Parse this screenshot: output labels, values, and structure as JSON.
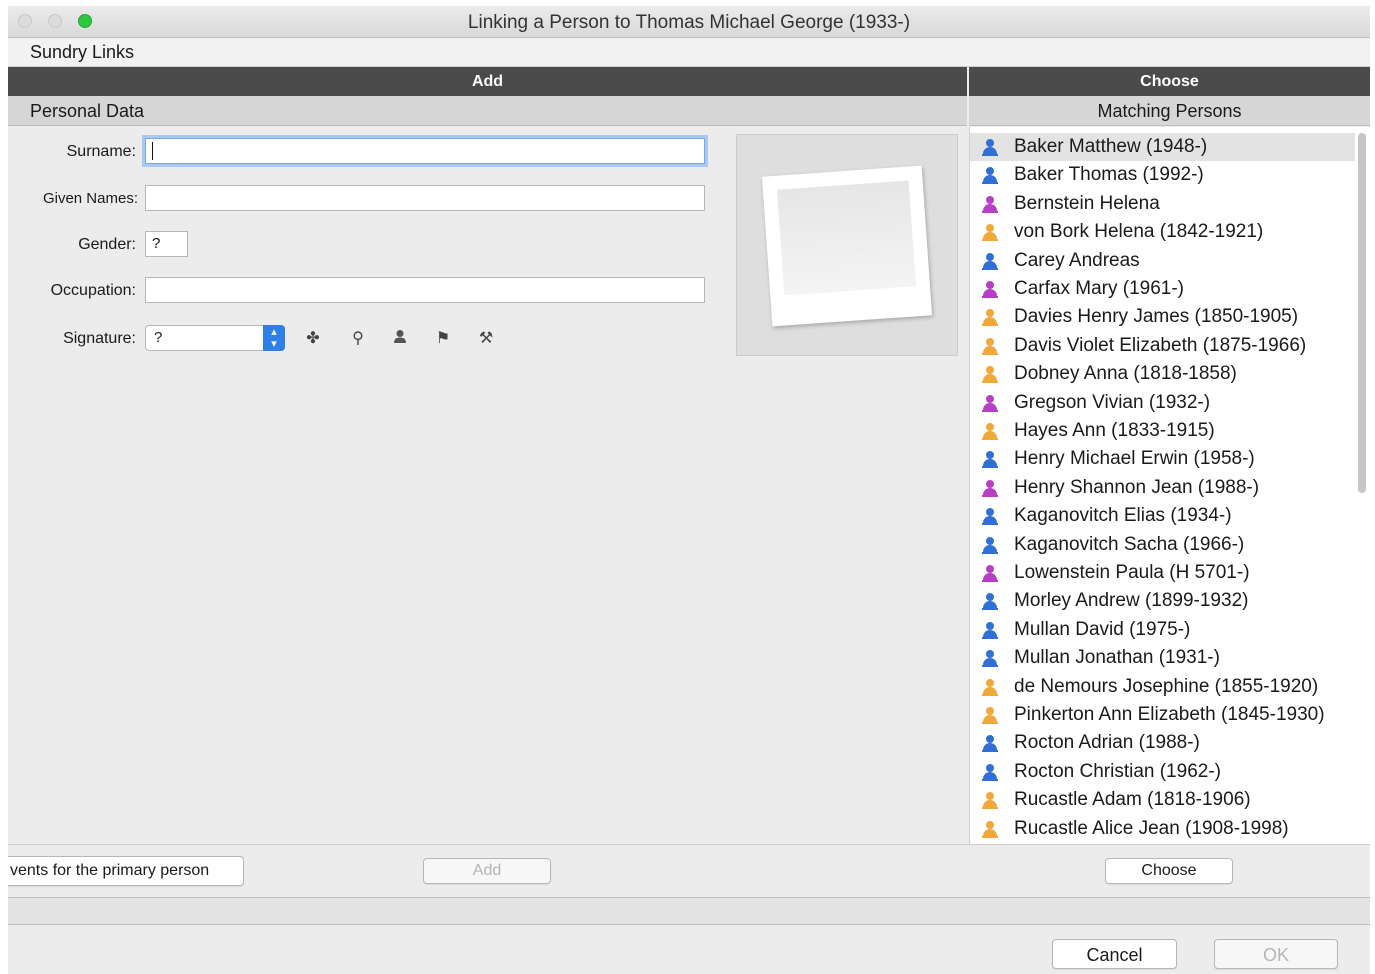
{
  "window": {
    "title": "Linking a Person to Thomas Michael George (1933-)"
  },
  "header": {
    "sundry_links": "Sundry Links"
  },
  "panels": {
    "add": "Add",
    "choose": "Choose",
    "personal_data": "Personal Data",
    "matching_persons": "Matching Persons"
  },
  "form": {
    "surname_label": "Surname:",
    "surname_value": "",
    "given_names_label": "Given Names:",
    "given_names_value": "",
    "gender_label": "Gender:",
    "gender_value": "?",
    "occupation_label": "Occupation:",
    "occupation_value": "",
    "signature_label": "Signature:",
    "signature_value": "?",
    "signature_tools": [
      "birth-icon",
      "death-icon",
      "person-icon",
      "flag-icon",
      "gavel-icon"
    ]
  },
  "colors": {
    "male": "#2f6fd6",
    "female": "#b63fc6",
    "unknown": "#f0a83a",
    "selected_row": "#e3e3e3"
  },
  "persons": [
    {
      "name": "Baker Matthew (1948-)",
      "gender": "male",
      "selected": true
    },
    {
      "name": "Baker Thomas (1992-)",
      "gender": "male"
    },
    {
      "name": "Bernstein Helena",
      "gender": "female"
    },
    {
      "name": "von Bork Helena (1842-1921)",
      "gender": "unknown"
    },
    {
      "name": "Carey Andreas",
      "gender": "male"
    },
    {
      "name": "Carfax Mary (1961-)",
      "gender": "female"
    },
    {
      "name": "Davies Henry James (1850-1905)",
      "gender": "unknown"
    },
    {
      "name": "Davis Violet Elizabeth (1875-1966)",
      "gender": "unknown"
    },
    {
      "name": "Dobney Anna (1818-1858)",
      "gender": "unknown"
    },
    {
      "name": "Gregson Vivian (1932-)",
      "gender": "female"
    },
    {
      "name": "Hayes Ann (1833-1915)",
      "gender": "unknown"
    },
    {
      "name": "Henry Michael Erwin (1958-)",
      "gender": "male"
    },
    {
      "name": "Henry Shannon Jean (1988-)",
      "gender": "female"
    },
    {
      "name": "Kaganovitch Elias (1934-)",
      "gender": "male"
    },
    {
      "name": "Kaganovitch Sacha (1966-)",
      "gender": "male"
    },
    {
      "name": "Lowenstein Paula (H 5701-)",
      "gender": "female"
    },
    {
      "name": "Morley Andrew (1899-1932)",
      "gender": "male"
    },
    {
      "name": "Mullan David (1975-)",
      "gender": "male"
    },
    {
      "name": "Mullan Jonathan (1931-)",
      "gender": "male"
    },
    {
      "name": "de Nemours Josephine (1855-1920)",
      "gender": "unknown"
    },
    {
      "name": "Pinkerton Ann Elizabeth (1845-1930)",
      "gender": "unknown"
    },
    {
      "name": "Rocton Adrian (1988-)",
      "gender": "male"
    },
    {
      "name": "Rocton Christian (1962-)",
      "gender": "male"
    },
    {
      "name": "Rucastle Adam (1818-1906)",
      "gender": "unknown"
    },
    {
      "name": "Rucastle Alice Jean (1908-1998)",
      "gender": "unknown"
    }
  ],
  "actions": {
    "events_button": "vents for the primary person",
    "add_button": "Add",
    "choose_button": "Choose",
    "cancel_button": "Cancel",
    "ok_button": "OK"
  }
}
